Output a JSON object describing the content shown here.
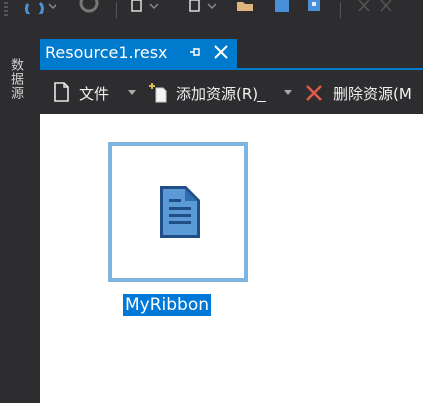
{
  "side_panel": {
    "tab_label": "数据源"
  },
  "document_tab": {
    "title": "Resource1.resx"
  },
  "resource_toolbar": {
    "file_label": "文件",
    "add_resource_label": "添加资源(R)",
    "add_resource_mnemonic": "R",
    "remove_resource_label": "删除资源(M"
  },
  "resources": [
    {
      "name": "MyRibbon",
      "icon": "text-file-icon",
      "selected": true
    }
  ],
  "colors": {
    "accent": "#007acc",
    "chrome": "#2d2d30",
    "selection": "#0078d7",
    "thumb_border": "#7eb4e0",
    "delete_x": "#e05a4a"
  }
}
